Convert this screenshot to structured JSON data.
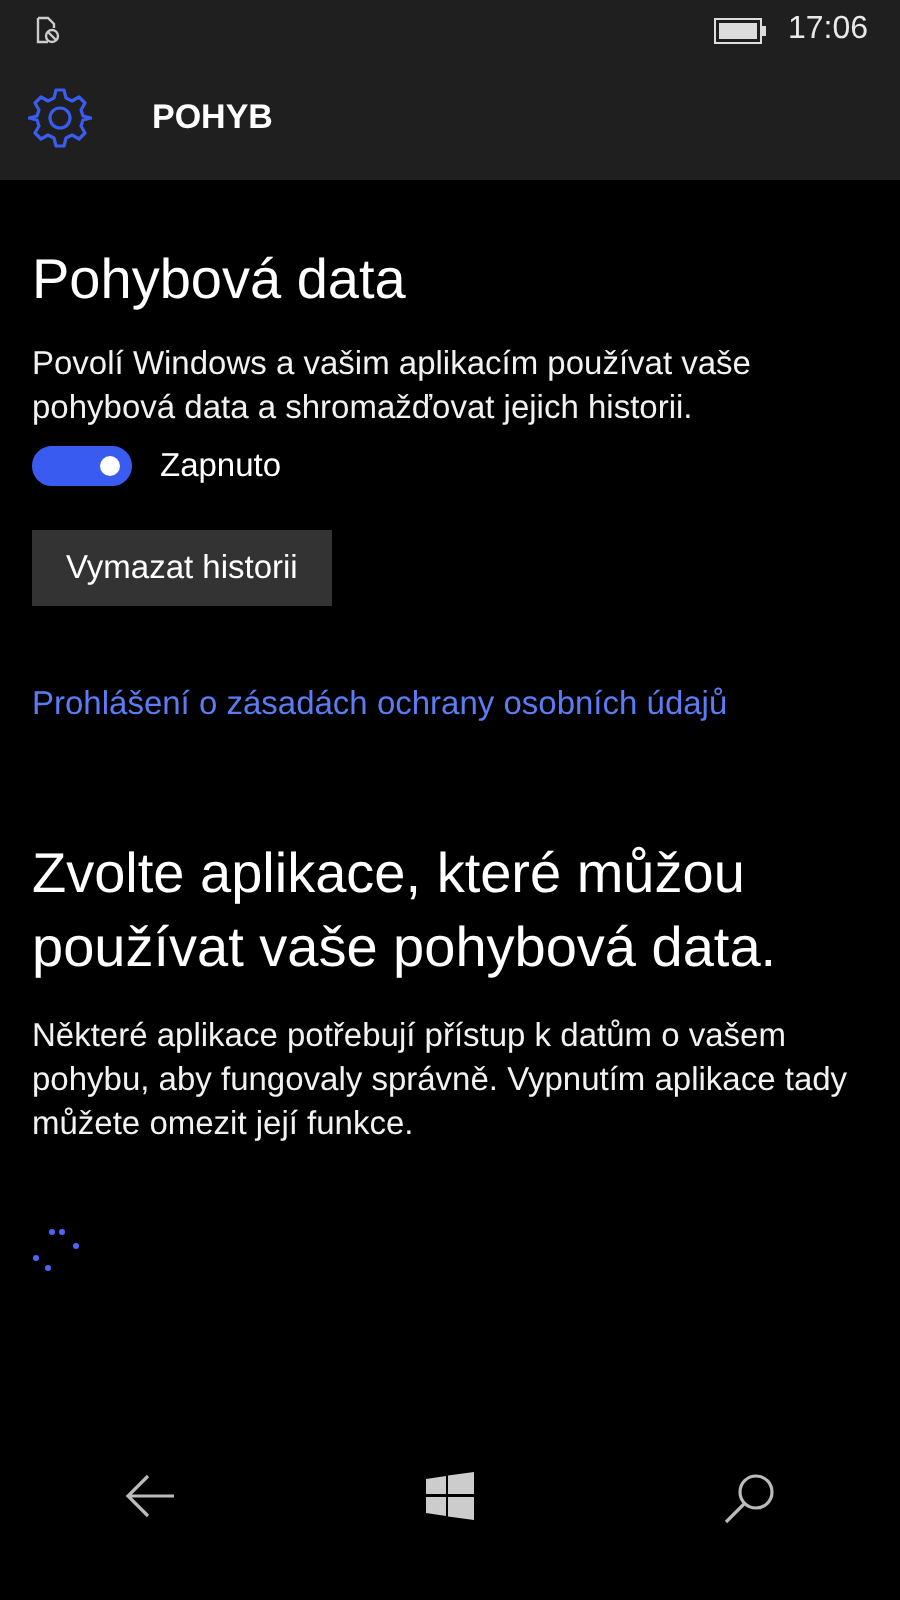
{
  "status_bar": {
    "time": "17:06"
  },
  "header": {
    "title": "POHYB"
  },
  "section": {
    "title": "Pohybová data",
    "description": "Povolí Windows a vašim aplikacím používat vaše pohybová data a shromažďovat jejich historii.",
    "toggle": {
      "on": true,
      "label": "Zapnuto"
    },
    "button": "Vymazat historii",
    "link": "Prohlášení o zásadách ochrany osobních údajů"
  },
  "apps_section": {
    "title": "Zvolte aplikace, které můžou používat vaše pohybová data.",
    "description": "Některé aplikace potřebují přístup k datům o vašem pohybu, aby fungovaly správně. Vypnutím aplikace tady můžete omezit její funkce."
  }
}
